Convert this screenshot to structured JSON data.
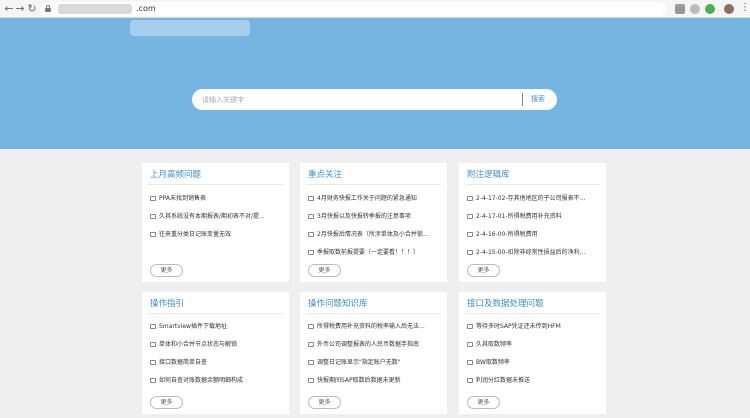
{
  "browser": {
    "url_suffix": ".com"
  },
  "search": {
    "placeholder": "请输入关键字",
    "button_label": "搜索"
  },
  "cards": [
    {
      "title": "上月高频问题",
      "items": [
        "PPA未找到销售表",
        "久其系统没有本期报表/期初表不对/提...",
        "往来重分类日记账变量无效"
      ],
      "more_label": "更多"
    },
    {
      "title": "重点关注",
      "items": [
        "4月财务快报工作关于问题的紧急通知",
        "3月快报以及快报转季报的注意事项",
        "2月快报后情况表（所涉单体及小合并锁...",
        "季报取数前报提要（一定要看！！！）"
      ],
      "more_label": "更多"
    },
    {
      "title": "附注逻辑库",
      "items": [
        "2-4-17-02-存其他地区的子公司报表不...",
        "2-4-17-01-所得税费用补充资料",
        "2-4-16-00-所得税费用",
        "2-4-15-00-扣除非经常性损益后的净利..."
      ],
      "more_label": "更多"
    },
    {
      "title": "操作指引",
      "items": [
        "Smartview插件下载地址",
        "单体和小合并节点状态与解锁",
        "接口数据简单自查",
        "如何自查对账数据余额明细构成"
      ],
      "more_label": "更多"
    },
    {
      "title": "操作问题知识库",
      "items": [
        "所得税费用补充资料的税率输入后无法...",
        "外币公司调整报表的人民币数据手指南",
        "调整日记账显示\"指定账户无数\"",
        "快报期间SAP取数后数据未更新"
      ],
      "more_label": "更多"
    },
    {
      "title": "接口及数据处理问题",
      "items": [
        "等待多时SAP凭证还未传到HFM",
        "久其取数频率",
        "BW取数频率",
        "利润分红数据未推送"
      ],
      "more_label": "更多"
    }
  ]
}
